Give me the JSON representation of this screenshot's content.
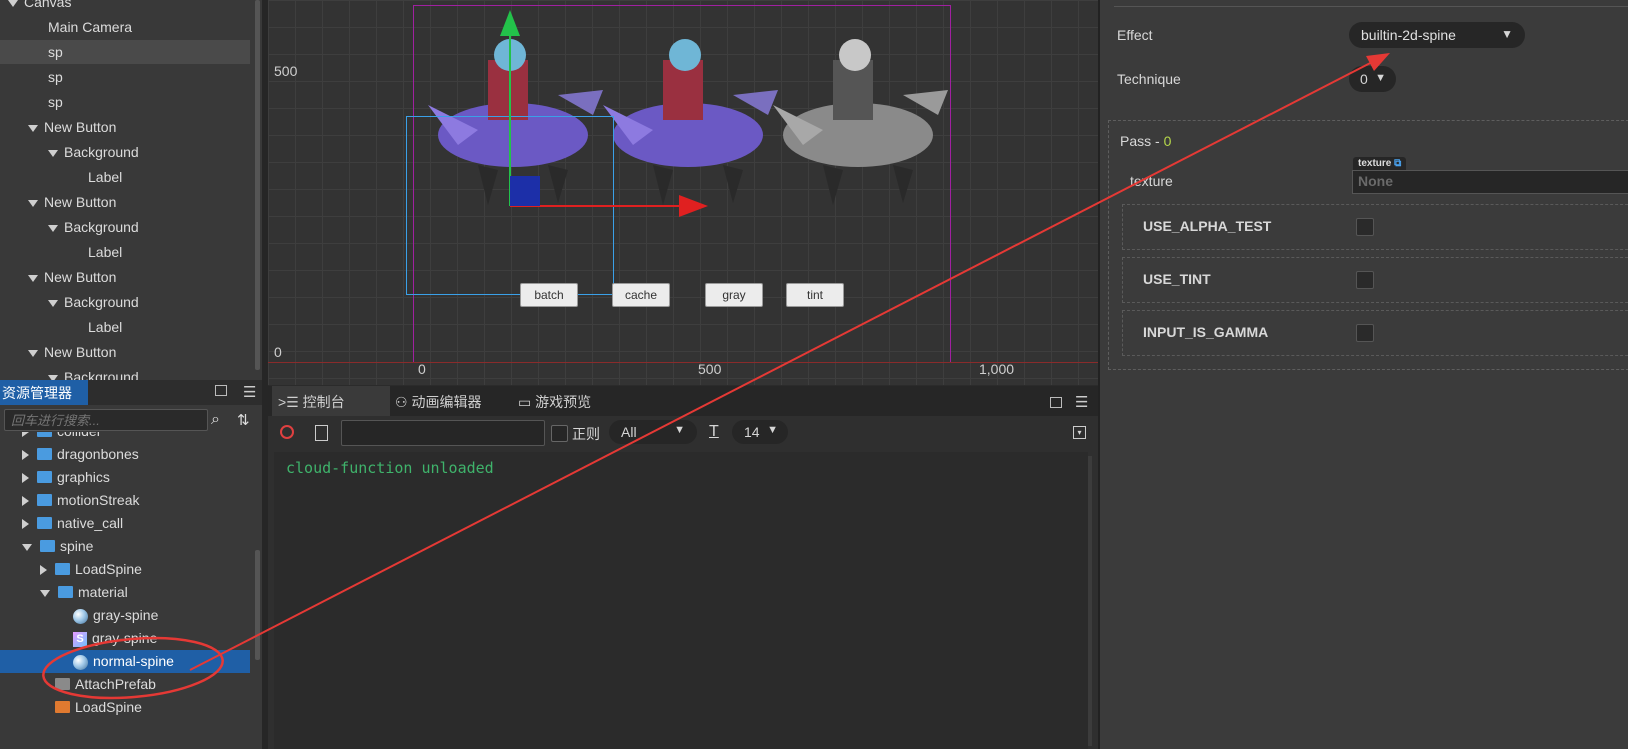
{
  "hierarchy": {
    "items": [
      {
        "label": "Canvas",
        "indent": 0,
        "arrow": "down",
        "selected": false
      },
      {
        "label": "Main Camera",
        "indent": 1,
        "arrow": "",
        "selected": false
      },
      {
        "label": "sp",
        "indent": 1,
        "arrow": "",
        "selected": true
      },
      {
        "label": "sp",
        "indent": 1,
        "arrow": "",
        "selected": false
      },
      {
        "label": "sp",
        "indent": 1,
        "arrow": "",
        "selected": false
      },
      {
        "label": "New Button",
        "indent": 1,
        "arrow": "down",
        "selected": false
      },
      {
        "label": "Background",
        "indent": 2,
        "arrow": "down",
        "selected": false
      },
      {
        "label": "Label",
        "indent": 3,
        "arrow": "",
        "selected": false
      },
      {
        "label": "New Button",
        "indent": 1,
        "arrow": "down",
        "selected": false
      },
      {
        "label": "Background",
        "indent": 2,
        "arrow": "down",
        "selected": false
      },
      {
        "label": "Label",
        "indent": 3,
        "arrow": "",
        "selected": false
      },
      {
        "label": "New Button",
        "indent": 1,
        "arrow": "down",
        "selected": false
      },
      {
        "label": "Background",
        "indent": 2,
        "arrow": "down",
        "selected": false
      },
      {
        "label": "Label",
        "indent": 3,
        "arrow": "",
        "selected": false
      },
      {
        "label": "New Button",
        "indent": 1,
        "arrow": "down",
        "selected": false
      },
      {
        "label": "Background",
        "indent": 2,
        "arrow": "down",
        "selected": false
      }
    ]
  },
  "scene": {
    "y_labels": [
      "500",
      "0"
    ],
    "x_labels": [
      "0",
      "500",
      "1,000"
    ],
    "buttons": [
      "batch",
      "cache",
      "gray",
      "tint"
    ]
  },
  "assets": {
    "title": "资源管理器",
    "search_placeholder": "回车进行搜索...",
    "items": [
      {
        "label": "collider",
        "icon": "folder",
        "arrow": "right",
        "indent": 1
      },
      {
        "label": "dragonbones",
        "icon": "folder",
        "arrow": "right",
        "indent": 1
      },
      {
        "label": "graphics",
        "icon": "folder",
        "arrow": "right",
        "indent": 1
      },
      {
        "label": "motionStreak",
        "icon": "folder",
        "arrow": "right",
        "indent": 1
      },
      {
        "label": "native_call",
        "icon": "folder",
        "arrow": "right",
        "indent": 1
      },
      {
        "label": "spine",
        "icon": "folder",
        "arrow": "down",
        "indent": 1
      },
      {
        "label": "LoadSpine",
        "icon": "folder",
        "arrow": "right",
        "indent": 2
      },
      {
        "label": "material",
        "icon": "folder",
        "arrow": "down",
        "indent": 2
      },
      {
        "label": "gray-spine",
        "icon": "material",
        "arrow": "",
        "indent": 3
      },
      {
        "label": "gray-spine",
        "icon": "script",
        "arrow": "",
        "indent": 3
      },
      {
        "label": "normal-spine",
        "icon": "material",
        "arrow": "",
        "indent": 3,
        "selected": true
      },
      {
        "label": "AttachPrefab",
        "icon": "prefab",
        "arrow": "",
        "indent": 2
      },
      {
        "label": "LoadSpine",
        "icon": "scene",
        "arrow": "",
        "indent": 2
      }
    ]
  },
  "console": {
    "tabs": [
      "控制台",
      "动画编辑器",
      "游戏预览"
    ],
    "regex_label": "正则",
    "level_select": "All",
    "font_size": "14",
    "log_lines": [
      "cloud-function unloaded"
    ]
  },
  "inspector": {
    "effect_label": "Effect",
    "effect_value": "builtin-2d-spine",
    "technique_label": "Technique",
    "technique_value": "0",
    "pass_label": "Pass - ",
    "pass_index": "0",
    "texture_label": "texture",
    "texture_tag": "texture",
    "texture_value": "None",
    "defines": [
      "USE_ALPHA_TEST",
      "USE_TINT",
      "INPUT_IS_GAMMA"
    ]
  },
  "colors": {
    "accent_red": "#e53935",
    "selection": "#1f5fa6",
    "log_green": "#3fb36b"
  }
}
